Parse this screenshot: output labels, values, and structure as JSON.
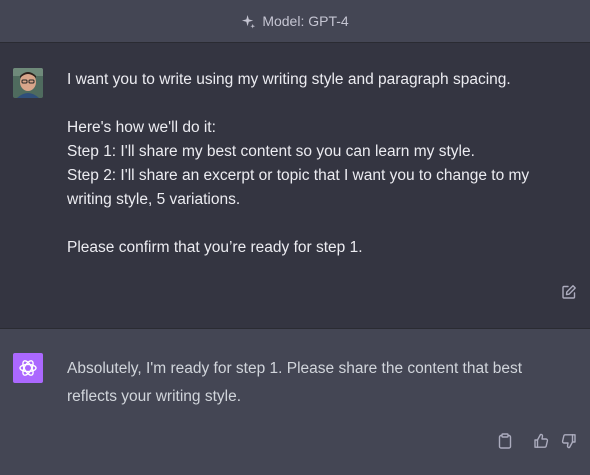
{
  "header": {
    "model_label": "Model: GPT-4",
    "icon": "sparkles-icon"
  },
  "conversation": {
    "user_message": {
      "avatar": "user-avatar",
      "paragraphs": [
        [
          "I want you to write using my writing style and paragraph spacing."
        ],
        [
          "Here's how we'll do it:",
          "Step 1: I'll share my best content so you can learn my style.",
          "Step 2: I'll share an excerpt or topic that I want you to change to my",
          "writing style, 5 variations."
        ],
        [
          "Please confirm that you’re ready for step 1."
        ]
      ],
      "actions": {
        "edit_icon": "edit-icon"
      }
    },
    "assistant_message": {
      "avatar": "openai-logo",
      "lines": [
        "Absolutely, I'm ready for step 1. Please share the content that best",
        "reflects your writing style."
      ],
      "actions": {
        "copy_icon": "clipboard-icon",
        "like_icon": "thumbs-up-icon",
        "dislike_icon": "thumbs-down-icon"
      }
    }
  },
  "colors": {
    "background": "#343541",
    "assistant_background": "#444654",
    "text": "#ececf1",
    "avatar_bot": "#ab68ff"
  }
}
